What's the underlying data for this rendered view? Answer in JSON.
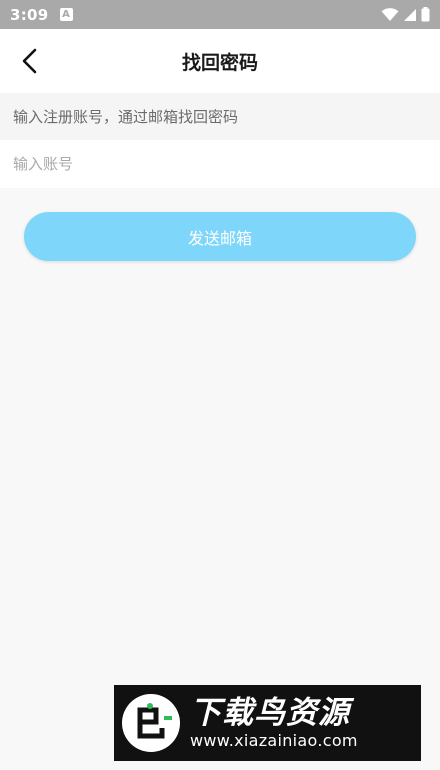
{
  "status_bar": {
    "time": "3:09",
    "notification_icon": "a-icon"
  },
  "header": {
    "title": "找回密码",
    "back_icon": "chevron-left-icon"
  },
  "hint": {
    "text": "输入注册账号，通过邮箱找回密码"
  },
  "account": {
    "placeholder": "输入账号",
    "value": ""
  },
  "send_button": {
    "label": "发送邮箱"
  },
  "watermark": {
    "title": "下载鸟资源",
    "url": "www.xiazainiao.com"
  },
  "colors": {
    "button": "#7fd6fb",
    "status_bar": "#a9a9a9",
    "background": "#f8f8f8"
  }
}
